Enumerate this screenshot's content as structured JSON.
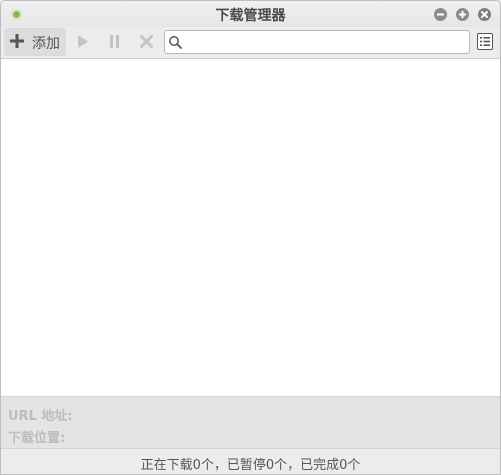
{
  "window": {
    "title": "下载管理器"
  },
  "toolbar": {
    "add_label": "添加",
    "search_value": "",
    "search_placeholder": ""
  },
  "details": {
    "url_label": "URL 地址:",
    "path_label": "下载位置:"
  },
  "status": {
    "text": "正在下载0个，已暂停0个，已完成0个"
  },
  "icons": {
    "app": "download-manager-icon",
    "minimize": "minimize-icon",
    "maximize": "maximize-icon",
    "close": "close-icon",
    "add": "plus-icon",
    "play": "play-icon",
    "pause": "pause-icon",
    "stop": "stop-icon",
    "search": "search-icon",
    "menu": "list-menu-icon"
  },
  "colors": {
    "app_icon": "#8aba56",
    "window_buttons": "#8c8c8c",
    "disabled_icons": "#c4c4c4"
  }
}
